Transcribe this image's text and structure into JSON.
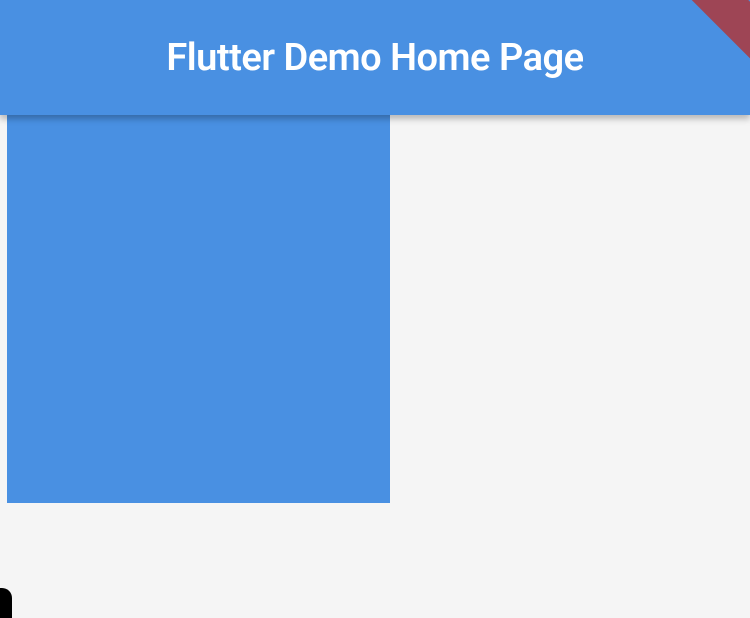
{
  "appBar": {
    "title": "Flutter Demo Home Page"
  },
  "colors": {
    "primary": "#4990E2",
    "background": "#F5F5F5"
  }
}
